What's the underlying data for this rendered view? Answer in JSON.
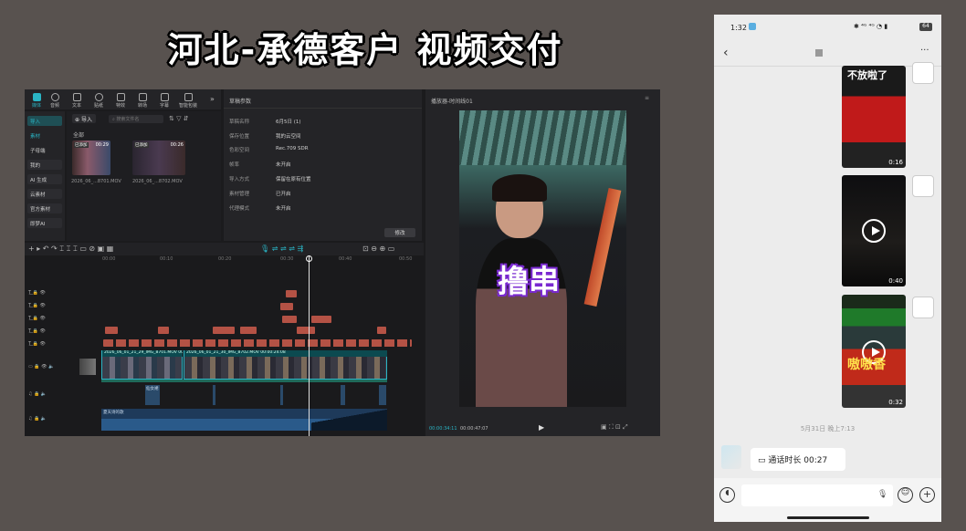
{
  "headline": "河北-承德客户  视频交付",
  "editor": {
    "toolbar": [
      "媒体",
      "音频",
      "文本",
      "贴纸",
      "特效",
      "转场",
      "字幕",
      "智能包装"
    ],
    "media": {
      "import_btn": "导入",
      "search_placeholder": "搜索文件名",
      "all_label": "全部",
      "side_items": [
        "导入",
        "素材",
        "子母端",
        "我的",
        "AI 生成",
        "云素材",
        "官方素材",
        "即梦AI"
      ],
      "clips": [
        {
          "tag": "已添加",
          "duration": "00:29",
          "name": "2026_06_...8701.MOV"
        },
        {
          "tag": "已添加",
          "duration": "00:26",
          "name": "2026_06_...8702.MOV"
        }
      ]
    },
    "props": {
      "title": "草稿参数",
      "rows": [
        {
          "k": "草稿名称",
          "v": "6月5日 (1)"
        },
        {
          "k": "保存位置",
          "v": "我的云空间"
        },
        {
          "k": "色彩空间",
          "v": "Rec.709 SDR"
        },
        {
          "k": "帧率",
          "v": "未开启"
        },
        {
          "k": "导入方式",
          "v": "保留在原有位置"
        },
        {
          "k": "素材管理",
          "v": "已开启"
        },
        {
          "k": "代理模式",
          "v": "未开启"
        }
      ],
      "edit_btn": "修改"
    },
    "player": {
      "title": "播放器-时间线01",
      "overlay": "撸串",
      "time_current": "00:00:34:11",
      "time_total": "00:00:47:07"
    },
    "timeline": {
      "ruler": [
        "00:00",
        "00:10",
        "00:20",
        "00:30",
        "00:40",
        "00:50"
      ],
      "main_clip_a": "2026_06_01_21_29_IMG_8701.MOV 00:00:29:08",
      "main_clip_b": "2026_06_01_21_30_IMG_8702.MOV 00:00:24:08",
      "audio1": "仙女裙",
      "audio2": "夏天诗的歌"
    }
  },
  "phone": {
    "time": "1:32",
    "battery": "64",
    "videos": [
      {
        "duration": "0:16",
        "sign": "不放啦了"
      },
      {
        "duration": "0:40"
      },
      {
        "duration": "0:32",
        "sign": "嗷嗷香"
      }
    ],
    "timestamp": "5月31日 晚上7:13",
    "call": "通话时长 00:27"
  }
}
